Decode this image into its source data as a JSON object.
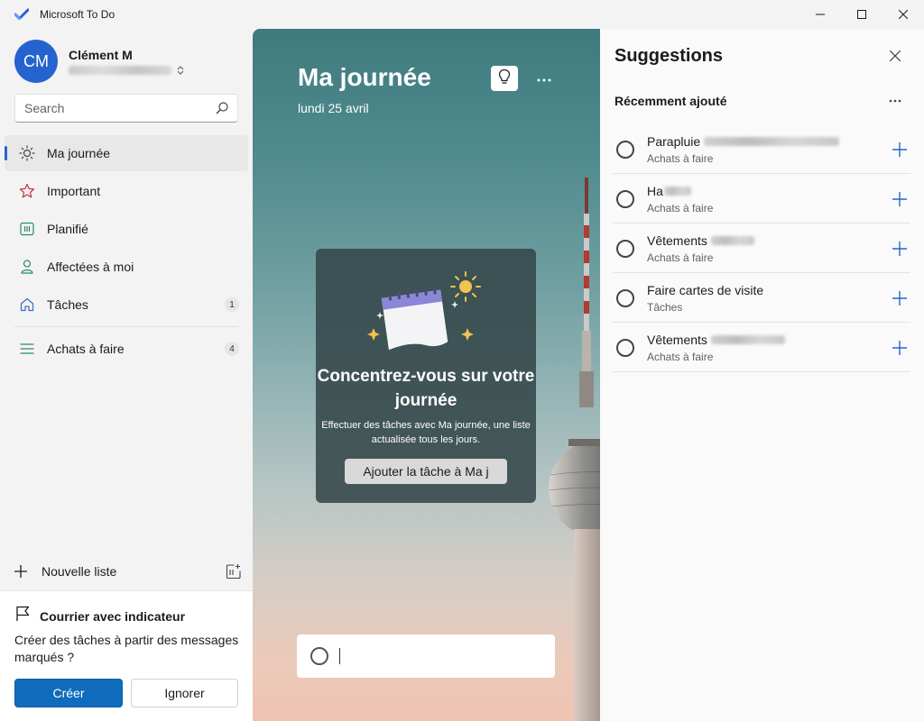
{
  "window": {
    "title": "Microsoft To Do",
    "controls": {
      "minimize": "minimize-icon",
      "maximize": "maximize-icon",
      "close": "close-icon"
    }
  },
  "profile": {
    "initials": "CM",
    "name": "Clément M"
  },
  "search": {
    "placeholder": "Search"
  },
  "nav": [
    {
      "label": "Ma journée",
      "icon": "sun-icon",
      "active": true
    },
    {
      "label": "Important",
      "icon": "star-icon"
    },
    {
      "label": "Planifié",
      "icon": "calendar-icon"
    },
    {
      "label": "Affectées à moi",
      "icon": "person-icon"
    },
    {
      "label": "Tâches",
      "icon": "home-icon",
      "count": "1"
    },
    {
      "label": "Achats à faire",
      "icon": "list-icon",
      "count": "4"
    }
  ],
  "new_list": {
    "label": "Nouvelle liste"
  },
  "flagged": {
    "title": "Courrier avec indicateur",
    "description": "Créer des tâches à partir des messages marqués ?",
    "create_label": "Créer",
    "ignore_label": "Ignorer"
  },
  "main": {
    "title": "Ma journée",
    "date": "lundi 25 avril",
    "focus_title": "Concentrez-vous sur votre journée",
    "focus_desc": "Effectuer des tâches avec Ma journée, une liste actualisée tous les jours.",
    "focus_button": "Ajouter la tâche à Ma j"
  },
  "suggestions": {
    "title": "Suggestions",
    "section": "Récemment ajouté",
    "items": [
      {
        "title": "Parapluie",
        "list": "Achats à faire"
      },
      {
        "title": "Ha",
        "list": "Achats à faire"
      },
      {
        "title": "Vêtements",
        "list": "Achats à faire"
      },
      {
        "title": "Faire cartes de visite",
        "list": "Tâches"
      },
      {
        "title": "Vêtements",
        "list": "Achats à faire"
      }
    ]
  },
  "colors": {
    "accent": "#2564cf",
    "primary_button": "#0f6cbd",
    "star": "#c5314b",
    "sidebar_bg": "#f3f3f3"
  }
}
